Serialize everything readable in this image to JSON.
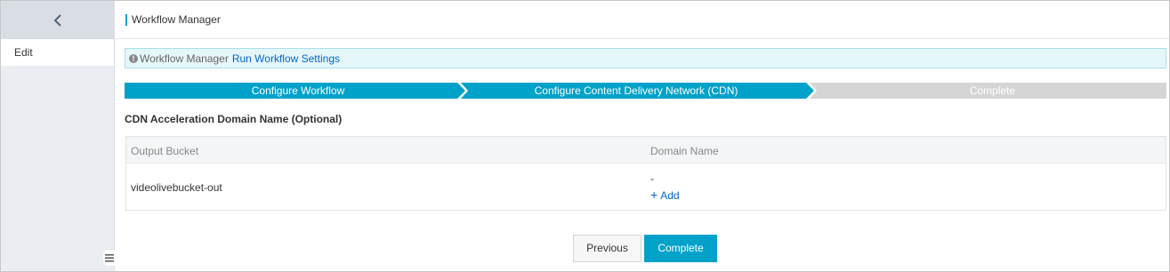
{
  "header": {
    "title": "Workflow Manager"
  },
  "sidebar": {
    "items": [
      {
        "label": "Edit"
      }
    ]
  },
  "banner": {
    "label": "Workflow Manager",
    "link": "Run Workflow Settings"
  },
  "steps": [
    {
      "label": "Configure Workflow",
      "status": "done"
    },
    {
      "label": "Configure Content Delivery Network (CDN)",
      "status": "active"
    },
    {
      "label": "Complete",
      "status": "pending"
    }
  ],
  "colors": {
    "active_step": "#00a2ca",
    "pending_step": "#d5d5d5",
    "link": "#0066cc"
  },
  "section": {
    "title": "CDN Acceleration Domain Name (Optional)"
  },
  "table": {
    "columns": [
      "Output Bucket",
      "Domain Name"
    ],
    "rows": [
      {
        "bucket": "videolivebucket-out",
        "domain": "-",
        "add_label": "Add"
      }
    ]
  },
  "buttons": {
    "previous": "Previous",
    "complete": "Complete"
  }
}
